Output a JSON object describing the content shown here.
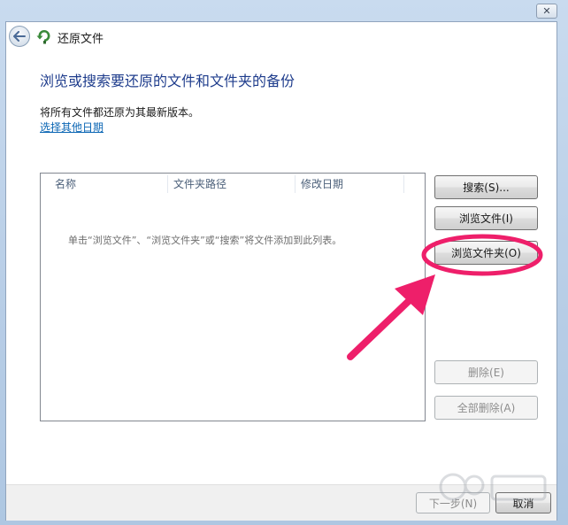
{
  "window": {
    "title": "还原文件",
    "close_glyph": "✕"
  },
  "main": {
    "heading": "浏览或搜索要还原的文件和文件夹的备份",
    "info": "将所有文件都还原为其最新版本。",
    "other_date_link": "选择其他日期"
  },
  "file_list": {
    "columns": [
      "名称",
      "文件夹路径",
      "修改日期"
    ],
    "empty_hint": "单击“浏览文件”、“浏览文件夹”或“搜索”将文件添加到此列表。"
  },
  "side_buttons": {
    "search": "搜索(S)...",
    "browse_files": "浏览文件(I)",
    "browse_folders": "浏览文件夹(O)",
    "remove": "删除(E)",
    "remove_all": "全部删除(A)"
  },
  "footer": {
    "next": "下一步(N)",
    "cancel": "取消"
  },
  "colors": {
    "heading": "#1e3c8c",
    "link": "#0b66b4",
    "annotation": "#ee1f6a"
  },
  "icons": {
    "back": "back-arrow-icon",
    "app": "restore-icon",
    "close": "close-icon"
  }
}
